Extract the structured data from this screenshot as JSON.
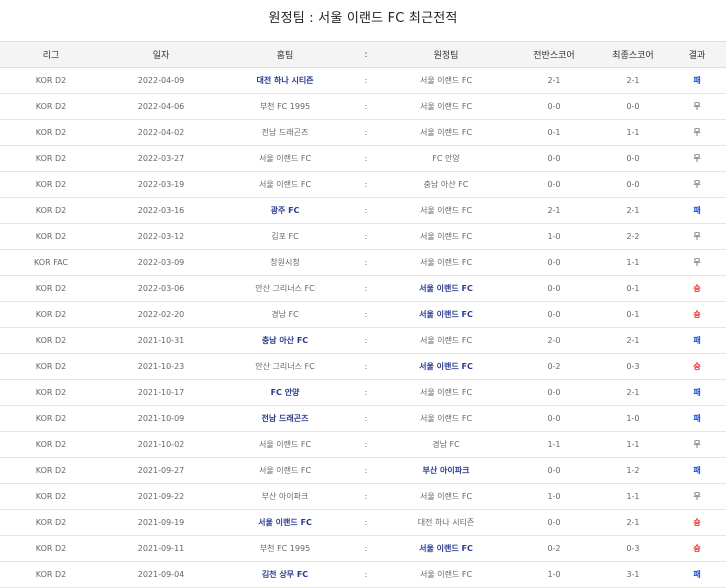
{
  "title": "원정팀 : 서울 이랜드 FC 최근전적",
  "headers": {
    "league": "리그",
    "date": "일자",
    "home": "홈팀",
    "sep": ":",
    "away": "원정팀",
    "half": "전반스코어",
    "final": "최종스코어",
    "result": "결과"
  },
  "colors": {
    "bold_team": "#2a3b8f",
    "loss": "#1a4fd6",
    "win": "#e02020"
  },
  "rows": [
    {
      "league": "KOR D2",
      "date": "2022-04-09",
      "home": "대전 하나 시티즌",
      "home_bold": true,
      "sep": ":",
      "away": "서울 이랜드 FC",
      "away_bold": false,
      "half": "2-1",
      "final": "2-1",
      "result": "패",
      "result_type": "loss"
    },
    {
      "league": "KOR D2",
      "date": "2022-04-06",
      "home": "부천 FC 1995",
      "home_bold": false,
      "sep": ":",
      "away": "서울 이랜드 FC",
      "away_bold": false,
      "half": "0-0",
      "final": "0-0",
      "result": "무",
      "result_type": "draw"
    },
    {
      "league": "KOR D2",
      "date": "2022-04-02",
      "home": "전남 드래곤즈",
      "home_bold": false,
      "sep": ":",
      "away": "서울 이랜드 FC",
      "away_bold": false,
      "half": "0-1",
      "final": "1-1",
      "result": "무",
      "result_type": "draw"
    },
    {
      "league": "KOR D2",
      "date": "2022-03-27",
      "home": "서울 이랜드 FC",
      "home_bold": false,
      "sep": ":",
      "away": "FC 안양",
      "away_bold": false,
      "half": "0-0",
      "final": "0-0",
      "result": "무",
      "result_type": "draw"
    },
    {
      "league": "KOR D2",
      "date": "2022-03-19",
      "home": "서울 이랜드 FC",
      "home_bold": false,
      "sep": ":",
      "away": "충남 아산 FC",
      "away_bold": false,
      "half": "0-0",
      "final": "0-0",
      "result": "무",
      "result_type": "draw"
    },
    {
      "league": "KOR D2",
      "date": "2022-03-16",
      "home": "광주 FC",
      "home_bold": true,
      "sep": ":",
      "away": "서울 이랜드 FC",
      "away_bold": false,
      "half": "2-1",
      "final": "2-1",
      "result": "패",
      "result_type": "loss"
    },
    {
      "league": "KOR D2",
      "date": "2022-03-12",
      "home": "김포 FC",
      "home_bold": false,
      "sep": ":",
      "away": "서울 이랜드 FC",
      "away_bold": false,
      "half": "1-0",
      "final": "2-2",
      "result": "무",
      "result_type": "draw"
    },
    {
      "league": "KOR FAC",
      "date": "2022-03-09",
      "home": "창원시청",
      "home_bold": false,
      "sep": ":",
      "away": "서울 이랜드 FC",
      "away_bold": false,
      "half": "0-0",
      "final": "1-1",
      "result": "무",
      "result_type": "draw"
    },
    {
      "league": "KOR D2",
      "date": "2022-03-06",
      "home": "안산 그리너스 FC",
      "home_bold": false,
      "sep": ":",
      "away": "서울 이랜드 FC",
      "away_bold": true,
      "half": "0-0",
      "final": "0-1",
      "result": "승",
      "result_type": "win"
    },
    {
      "league": "KOR D2",
      "date": "2022-02-20",
      "home": "경남 FC",
      "home_bold": false,
      "sep": ":",
      "away": "서울 이랜드 FC",
      "away_bold": true,
      "half": "0-0",
      "final": "0-1",
      "result": "승",
      "result_type": "win"
    },
    {
      "league": "KOR D2",
      "date": "2021-10-31",
      "home": "충남 아산 FC",
      "home_bold": true,
      "sep": ":",
      "away": "서울 이랜드 FC",
      "away_bold": false,
      "half": "2-0",
      "final": "2-1",
      "result": "패",
      "result_type": "loss"
    },
    {
      "league": "KOR D2",
      "date": "2021-10-23",
      "home": "안산 그리너스 FC",
      "home_bold": false,
      "sep": ":",
      "away": "서울 이랜드 FC",
      "away_bold": true,
      "half": "0-2",
      "final": "0-3",
      "result": "승",
      "result_type": "win"
    },
    {
      "league": "KOR D2",
      "date": "2021-10-17",
      "home": "FC 안양",
      "home_bold": true,
      "sep": ":",
      "away": "서울 이랜드 FC",
      "away_bold": false,
      "half": "0-0",
      "final": "2-1",
      "result": "패",
      "result_type": "loss"
    },
    {
      "league": "KOR D2",
      "date": "2021-10-09",
      "home": "전남 드래곤즈",
      "home_bold": true,
      "sep": ":",
      "away": "서울 이랜드 FC",
      "away_bold": false,
      "half": "0-0",
      "final": "1-0",
      "result": "패",
      "result_type": "loss"
    },
    {
      "league": "KOR D2",
      "date": "2021-10-02",
      "home": "서울 이랜드 FC",
      "home_bold": false,
      "sep": ":",
      "away": "경남 FC",
      "away_bold": false,
      "half": "1-1",
      "final": "1-1",
      "result": "무",
      "result_type": "draw"
    },
    {
      "league": "KOR D2",
      "date": "2021-09-27",
      "home": "서울 이랜드 FC",
      "home_bold": false,
      "sep": ":",
      "away": "부산 아이파크",
      "away_bold": true,
      "half": "0-0",
      "final": "1-2",
      "result": "패",
      "result_type": "loss"
    },
    {
      "league": "KOR D2",
      "date": "2021-09-22",
      "home": "부산 아이파크",
      "home_bold": false,
      "sep": ":",
      "away": "서울 이랜드 FC",
      "away_bold": false,
      "half": "1-0",
      "final": "1-1",
      "result": "무",
      "result_type": "draw"
    },
    {
      "league": "KOR D2",
      "date": "2021-09-19",
      "home": "서울 이랜드 FC",
      "home_bold": true,
      "sep": ":",
      "away": "대전 하나 시티즌",
      "away_bold": false,
      "half": "0-0",
      "final": "2-1",
      "result": "승",
      "result_type": "win"
    },
    {
      "league": "KOR D2",
      "date": "2021-09-11",
      "home": "부천 FC 1995",
      "home_bold": false,
      "sep": ":",
      "away": "서울 이랜드 FC",
      "away_bold": true,
      "half": "0-2",
      "final": "0-3",
      "result": "승",
      "result_type": "win"
    },
    {
      "league": "KOR D2",
      "date": "2021-09-04",
      "home": "김천 상무 FC",
      "home_bold": true,
      "sep": ":",
      "away": "서울 이랜드 FC",
      "away_bold": false,
      "half": "1-0",
      "final": "3-1",
      "result": "패",
      "result_type": "loss"
    }
  ]
}
